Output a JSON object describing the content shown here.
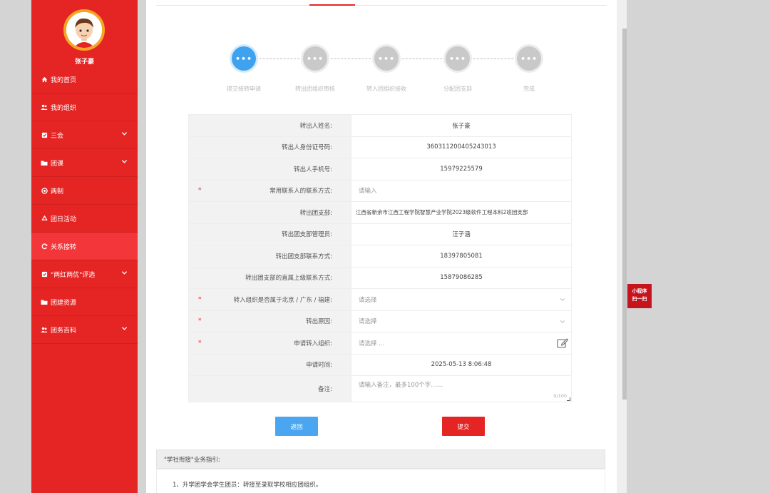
{
  "user": {
    "name": "张子豪"
  },
  "sidebar": {
    "items": [
      {
        "label": "我的首页",
        "icon": "home-icon",
        "has_submenu": false,
        "active": false
      },
      {
        "label": "我的组织",
        "icon": "users-icon",
        "has_submenu": false,
        "active": false
      },
      {
        "label": "三会",
        "icon": "checkbox-icon",
        "has_submenu": true,
        "active": false
      },
      {
        "label": "团课",
        "icon": "folder-icon",
        "has_submenu": true,
        "active": false
      },
      {
        "label": "两制",
        "icon": "circle-icon",
        "has_submenu": false,
        "active": false
      },
      {
        "label": "团日活动",
        "icon": "recycle-icon",
        "has_submenu": false,
        "active": false
      },
      {
        "label": "关系接转",
        "icon": "refresh-icon",
        "has_submenu": false,
        "active": true
      },
      {
        "label": "\"两红两优\"评选",
        "icon": "checkbox-icon",
        "has_submenu": true,
        "active": false
      },
      {
        "label": "团建资源",
        "icon": "folder-icon",
        "has_submenu": false,
        "active": false
      },
      {
        "label": "团务百科",
        "icon": "users-icon",
        "has_submenu": true,
        "active": false
      }
    ]
  },
  "steps": [
    {
      "label": "提交接转申请",
      "active": true
    },
    {
      "label": "转出团组织审核",
      "active": false
    },
    {
      "label": "转入团组织接收",
      "active": false
    },
    {
      "label": "分配团支部",
      "active": false
    },
    {
      "label": "完成",
      "active": false
    }
  ],
  "form": {
    "rows": [
      {
        "label": "转出人姓名:",
        "value": "张子豪",
        "required": false,
        "kind": "text"
      },
      {
        "label": "转出人身份证号码:",
        "value": "360311200405243013",
        "required": false,
        "kind": "text"
      },
      {
        "label": "转出人手机号:",
        "value": "15979225579",
        "required": false,
        "kind": "text"
      },
      {
        "label": "常用联系人的联系方式:",
        "value": "请输入",
        "required": true,
        "kind": "input"
      },
      {
        "label": "转出团支部:",
        "value": "江西省新余市江西工程学院智慧产业学院2023级软件工程本科2班团支部",
        "required": false,
        "kind": "addr"
      },
      {
        "label": "转出团支部管理员:",
        "value": "汪子涵",
        "required": false,
        "kind": "text"
      },
      {
        "label": "转出团支部联系方式:",
        "value": "18397805081",
        "required": false,
        "kind": "text"
      },
      {
        "label": "转出团支部的直属上级联系方式:",
        "value": "15879086285",
        "required": false,
        "kind": "text"
      },
      {
        "label": "转入组织是否属于北京 / 广东 / 福建:",
        "value": "请选择",
        "required": true,
        "kind": "select"
      },
      {
        "label": "转出原因:",
        "value": "请选择",
        "required": true,
        "kind": "select"
      },
      {
        "label": "申请转入组织:",
        "value": "请选择 ...",
        "required": true,
        "kind": "picker"
      },
      {
        "label": "申请时间:",
        "value": "2025-05-13 8:06:48",
        "required": false,
        "kind": "text"
      }
    ],
    "remark": {
      "label": "备注:",
      "placeholder": "请输入备注，最多100个字……",
      "counter": "0/100"
    }
  },
  "buttons": {
    "back": "返回",
    "submit": "提交"
  },
  "guide": {
    "title": "\"学社衔接\"业务指引:",
    "item1": "1、升学团学会学生团员：转接至录取学校相应团组织。"
  },
  "mini_program_tag": {
    "line1": "小程序",
    "line2": "扫一扫"
  },
  "colors": {
    "primary_red": "#e42524",
    "active_blue": "#3ea2ef",
    "submit_red": "#e42524",
    "back_blue": "#4aa6f0"
  }
}
